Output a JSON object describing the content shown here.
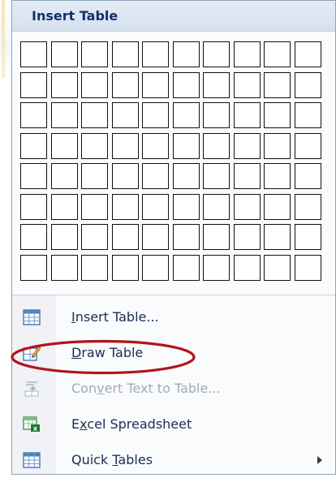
{
  "menu": {
    "title": "Insert Table",
    "grid": {
      "rows": 8,
      "columns": 10
    },
    "items": [
      {
        "label_pre": "",
        "mnemonic": "I",
        "label_post": "nsert Table...",
        "icon": "table-grid-icon",
        "enabled": true
      },
      {
        "label_pre": "",
        "mnemonic": "D",
        "label_post": "raw Table",
        "icon": "draw-table-pencil-icon",
        "enabled": true
      },
      {
        "label_pre": "Con",
        "mnemonic": "v",
        "label_post": "ert Text to Table...",
        "icon": "convert-text-to-table-icon",
        "enabled": false
      },
      {
        "label_pre": "E",
        "mnemonic": "x",
        "label_post": "cel Spreadsheet",
        "icon": "excel-spreadsheet-icon",
        "enabled": true
      },
      {
        "label_pre": "Quick ",
        "mnemonic": "T",
        "label_post": "ables",
        "icon": "quick-tables-icon",
        "enabled": true,
        "submenu": true
      }
    ]
  },
  "annotation": {
    "highlighted_item": "Draw Table",
    "color": "#b0151d"
  }
}
